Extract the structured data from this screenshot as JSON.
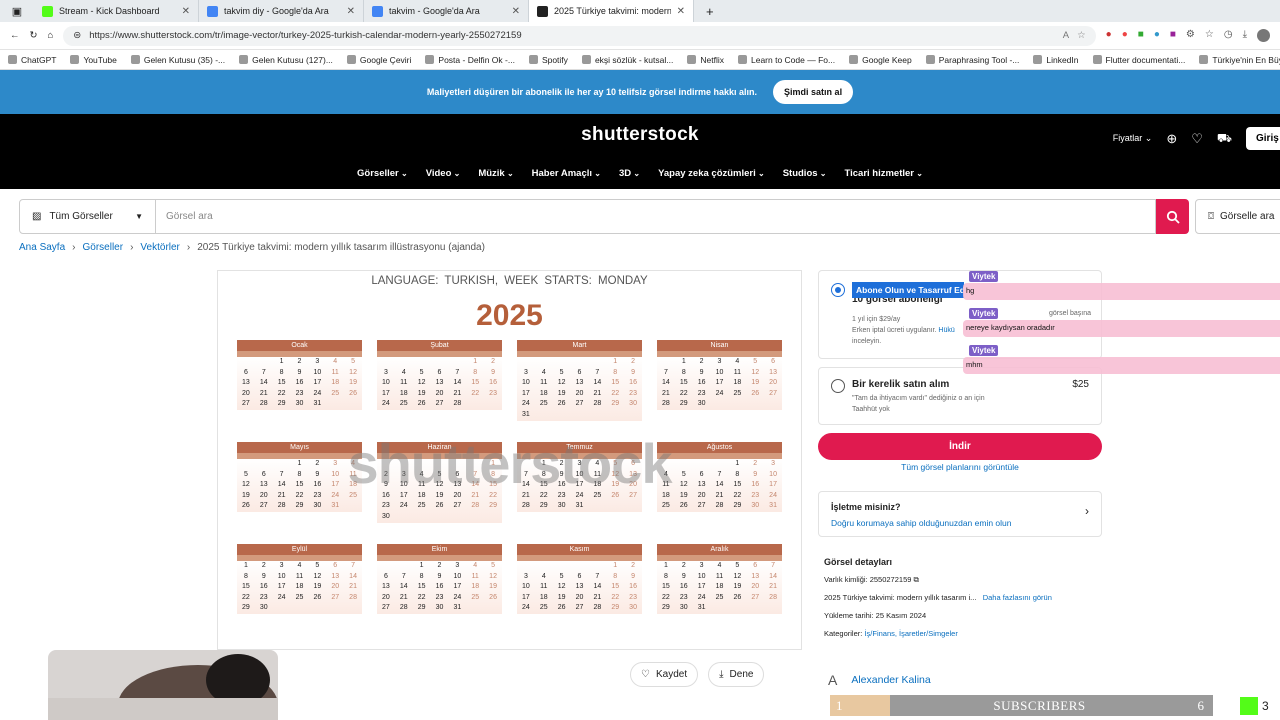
{
  "tabs": [
    {
      "label": "Stream - Kick Dashboard",
      "color": "#53fc18"
    },
    {
      "label": "takvim diy - Google'da Ara",
      "color": "#4285f4"
    },
    {
      "label": "takvim - Google'da Ara",
      "color": "#4285f4"
    },
    {
      "label": "2025 Türkiye takvimi: modern yıllı",
      "color": "#222222"
    }
  ],
  "address": {
    "url": "https://www.shutterstock.com/tr/image-vector/turkey-2025-turkish-calendar-modern-yearly-2550272159"
  },
  "bookmarks": [
    "ChatGPT",
    "YouTube",
    "Gelen Kutusu (35) -...",
    "Gelen Kutusu (127)...",
    "Google Çeviri",
    "Posta - Delfin Ok -...",
    "Spotify",
    "ekşi sözlük - kutsal...",
    "Netflix",
    "Learn to Code — Fo...",
    "Google Keep",
    "Paraphrasing Tool -...",
    "LinkedIn",
    "Flutter documentati...",
    "Türkiye'nin En Büyü..."
  ],
  "promo": {
    "text": "Maliyetleri düşüren bir abonelik ile her ay 10 telifsiz görsel indirme hakkı alın.",
    "button": "Şimdi satın al"
  },
  "header": {
    "logo": "shutterstock",
    "pricing": "Fiyatlar",
    "login": "Giriş",
    "nav": [
      "Görseller",
      "Video",
      "Müzik",
      "Haber Amaçlı",
      "3D",
      "Yapay zeka çözümleri",
      "Studios",
      "Ticari hizmetler"
    ]
  },
  "search": {
    "category": "Tüm Görseller",
    "placeholder": "Görsel ara",
    "image_search": "Görselle ara"
  },
  "breadcrumb": [
    "Ana Sayfa",
    "Görseller",
    "Vektörler",
    "2025 Türkiye takvimi: modern yıllık tasarım illüstrasyonu (ajanda)"
  ],
  "preview": {
    "header": "LANGUAGE: TURKISH,    WEEK STARTS: MONDAY",
    "year": "2025",
    "watermark": "shutterstock",
    "weekdays": [
      "P",
      "S",
      "Ç",
      "P",
      "C",
      "C",
      "P"
    ],
    "months": [
      {
        "name": "Ocak",
        "start": 2,
        "days": 31
      },
      {
        "name": "Şubat",
        "start": 5,
        "days": 28
      },
      {
        "name": "Mart",
        "start": 5,
        "days": 31
      },
      {
        "name": "Nisan",
        "start": 1,
        "days": 30
      },
      {
        "name": "Mayıs",
        "start": 3,
        "days": 31
      },
      {
        "name": "Haziran",
        "start": 6,
        "days": 30
      },
      {
        "name": "Temmuz",
        "start": 1,
        "days": 31
      },
      {
        "name": "Ağustos",
        "start": 4,
        "days": 31
      },
      {
        "name": "Eylül",
        "start": 0,
        "days": 30
      },
      {
        "name": "Ekim",
        "start": 2,
        "days": 31
      },
      {
        "name": "Kasım",
        "start": 5,
        "days": 30
      },
      {
        "name": "Aralık",
        "start": 0,
        "days": 31
      }
    ]
  },
  "actions": {
    "save": "Kaydet",
    "try": "Dene"
  },
  "purchase": {
    "subscribe_badge": "Abone Olun ve Tasarruf Ed",
    "subscribe_title": "10 görsel aboneliği",
    "subscribe_note1": "1 yıl için $29/ay",
    "subscribe_note2": "Erken iptal ücreti uygulanır.",
    "subscribe_link": "Hükü",
    "subscribe_note3": "inceleyin.",
    "per_image": "görsel başına",
    "once_title": "Bir kerelik satın alım",
    "once_price": "$25",
    "once_note1": "\"Tam da ihtiyacım vardı\" dediğiniz o an için",
    "once_note2": "Taahhüt yok",
    "download": "İndir",
    "all_plans": "Tüm görsel planlarını görüntüle"
  },
  "business": {
    "title": "İşletme misiniz?",
    "link": "Doğru korumaya sahip olduğunuzdan emin olun"
  },
  "details": {
    "title": "Görsel detayları",
    "asset_id": "Varlık kimliği: 2550272159",
    "desc": "2025 Türkiye takvimi: modern yıllık tasarım i...",
    "more": "Daha fazlasını görün",
    "uploaded": "Yükleme tarihi: 25 Kasım 2024",
    "categories_label": "Kategoriler:",
    "categories": "İş/Finans, İşaretler/Simgeler"
  },
  "author": {
    "initial": "A",
    "name": "Alexander Kalina"
  },
  "chat": [
    {
      "user": "Viytek",
      "text": "hg"
    },
    {
      "user": "Viytek",
      "text": "nereye kaydıysan oradadır"
    },
    {
      "user": "Viytek",
      "text": "mhm"
    }
  ],
  "subscribers": {
    "left": "1",
    "label": "SUBSCRIBERS",
    "right": "6",
    "progress": 0.17
  },
  "kick_counter": "3"
}
